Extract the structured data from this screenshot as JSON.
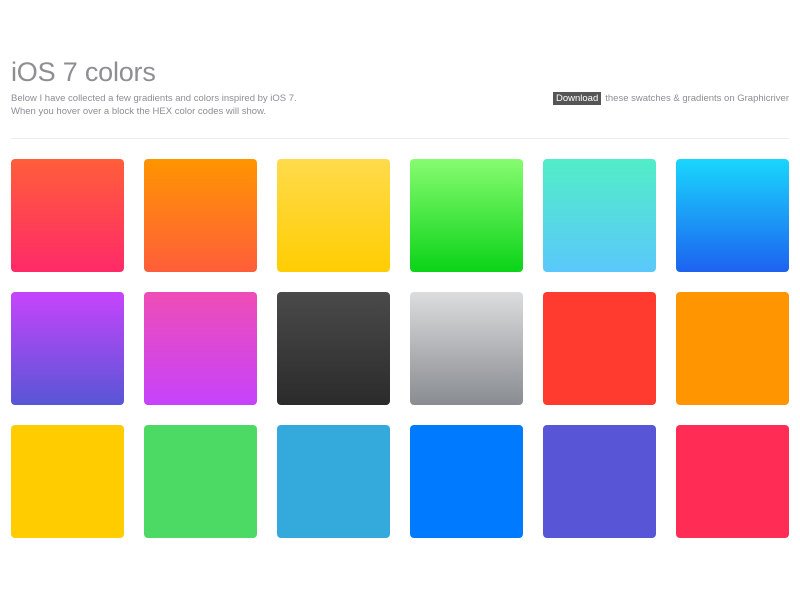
{
  "header": {
    "title": "iOS 7 colors",
    "desc_line1": "Below I have collected a few gradients and colors inspired by iOS 7.",
    "desc_line2": "When you hover over a block the HEX color codes will show.",
    "download_label": "Download",
    "download_suffix": "these swatches & gradients on Graphicriver"
  },
  "swatches": [
    {
      "name": "red-gradient",
      "top": "#ff5e3a",
      "bottom": "#ff2a68"
    },
    {
      "name": "orange-gradient",
      "top": "#ff9500",
      "bottom": "#ff5e3a"
    },
    {
      "name": "yellow-gradient",
      "top": "#ffdb4c",
      "bottom": "#ffcd02"
    },
    {
      "name": "green-gradient",
      "top": "#87fc70",
      "bottom": "#0bd318"
    },
    {
      "name": "teal-gradient",
      "top": "#52edc7",
      "bottom": "#5ac8fb"
    },
    {
      "name": "blue-gradient",
      "top": "#1ad6fd",
      "bottom": "#1d62f0"
    },
    {
      "name": "violet-gradient",
      "top": "#c644fc",
      "bottom": "#5856d6"
    },
    {
      "name": "magenta-gradient",
      "top": "#ef4db6",
      "bottom": "#c643fc"
    },
    {
      "name": "black-gradient",
      "top": "#4a4a4a",
      "bottom": "#2b2b2b"
    },
    {
      "name": "silver-gradient",
      "top": "#dbddde",
      "bottom": "#898c90"
    },
    {
      "name": "red-solid",
      "top": "#ff3b30",
      "bottom": "#ff3b30"
    },
    {
      "name": "orange-solid",
      "top": "#ff9500",
      "bottom": "#ff9500"
    },
    {
      "name": "yellow-solid",
      "top": "#ffcc00",
      "bottom": "#ffcc00"
    },
    {
      "name": "green-solid",
      "top": "#4cd964",
      "bottom": "#4cd964"
    },
    {
      "name": "light-blue-solid",
      "top": "#34aadc",
      "bottom": "#34aadc"
    },
    {
      "name": "blue-solid",
      "top": "#007aff",
      "bottom": "#007aff"
    },
    {
      "name": "purple-solid",
      "top": "#5856d6",
      "bottom": "#5856d6"
    },
    {
      "name": "pink-solid",
      "top": "#ff2d55",
      "bottom": "#ff2d55"
    }
  ]
}
